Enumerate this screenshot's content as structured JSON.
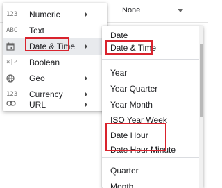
{
  "top_field": {
    "value": "None"
  },
  "menu": {
    "items": [
      {
        "icon_name": "number-icon",
        "icon_text": "123",
        "label": "Numeric",
        "has_submenu": true
      },
      {
        "icon_name": "text-icon",
        "icon_text": "ABC",
        "label": "Text",
        "has_submenu": false
      },
      {
        "icon_name": "calendar-icon",
        "icon_text": "",
        "label": "Date & Time",
        "has_submenu": true,
        "selected": true
      },
      {
        "icon_name": "boolean-icon",
        "icon_text": "×|✓",
        "label": "Boolean",
        "has_submenu": false
      },
      {
        "icon_name": "globe-icon",
        "icon_text": "",
        "label": "Geo",
        "has_submenu": true
      },
      {
        "icon_name": "currency-icon",
        "icon_text": "123",
        "label": "Currency",
        "has_submenu": true
      },
      {
        "icon_name": "link-icon",
        "icon_text": "",
        "label": "URL",
        "has_submenu": true
      }
    ]
  },
  "submenu": {
    "items": [
      "Date",
      "Date & Time",
      "Year",
      "Year Quarter",
      "Year Month",
      "ISO Year Week",
      "Date Hour",
      "Date Hour Minute",
      "Quarter",
      "Month"
    ]
  },
  "highlight_color": "#d9232d"
}
